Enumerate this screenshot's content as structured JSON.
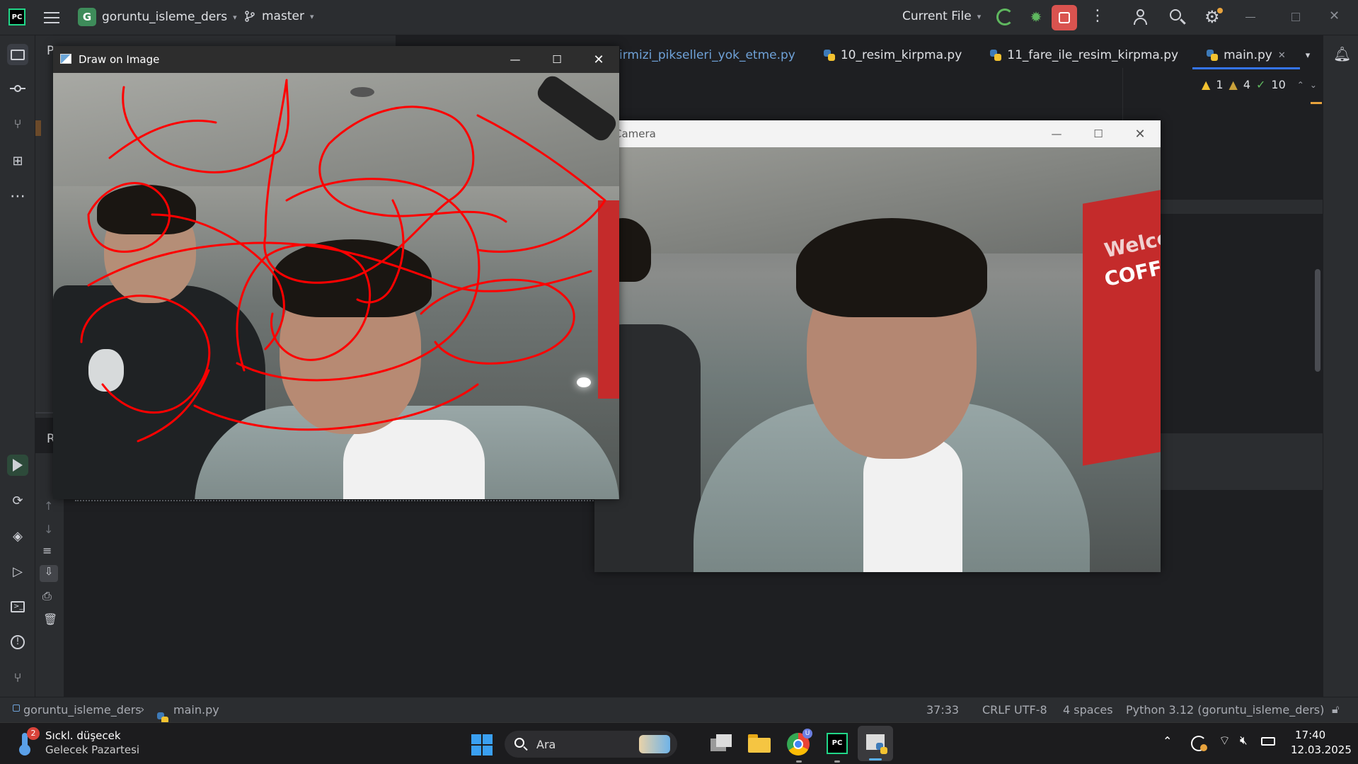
{
  "titlebar": {
    "project_name": "goruntu_isleme_ders",
    "project_initial": "G",
    "branch": "master",
    "run_config": "Current File"
  },
  "editor": {
    "tabs": [
      {
        "label": "irmizi_pikselleri_yok_etme.py"
      },
      {
        "label": "10_resim_kirpma.py"
      },
      {
        "label": "11_fare_ile_resim_kirpma.py"
      },
      {
        "label": "main.py",
        "active": true
      }
    ],
    "inspections": {
      "warnings": "1",
      "weak_warnings": "4",
      "ok": "10"
    },
    "partial_panel_letter": "P",
    "partial_run_letter": "R"
  },
  "draw_window": {
    "title": "Draw on Image"
  },
  "camera_window": {
    "title": "Camera",
    "sign_text_1": "Welco",
    "sign_text_2": "COFFE"
  },
  "statusbar": {
    "breadcrumb_project": "goruntu_isleme_ders",
    "breadcrumb_file": "main.py",
    "position": "37:33",
    "line_sep": "CRLF",
    "encoding": "UTF-8",
    "indent": "4 spaces",
    "interpreter": "Python 3.12 (goruntu_isleme_ders)"
  },
  "taskbar": {
    "weather_line1": "Sıckl. düşecek",
    "weather_line2": "Gelecek Pazartesi",
    "weather_badge": "2",
    "search_placeholder": "Ara",
    "time": "17:40",
    "date": "12.03.2025"
  },
  "colors": {
    "ide_bg": "#1e1f22",
    "panel_bg": "#2b2d30",
    "stop_button": "#d9534f",
    "run_green": "#5fb85f",
    "drawing_red": "#ff0000"
  }
}
